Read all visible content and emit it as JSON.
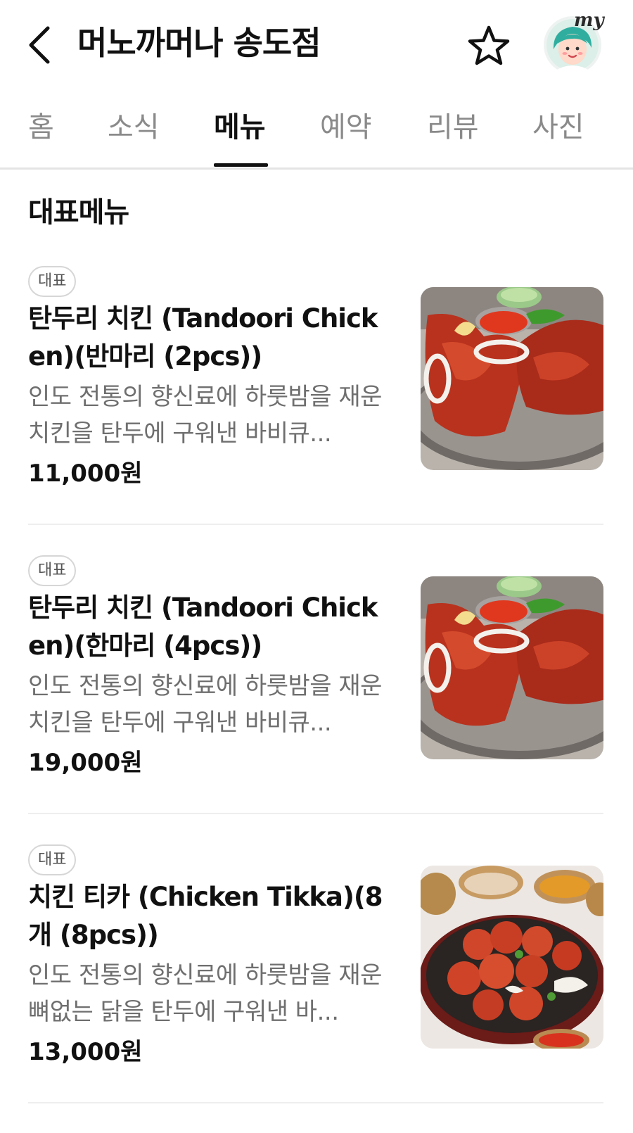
{
  "header": {
    "title": "머노까머나 송도점",
    "back_icon": "chevron-left-icon",
    "favorite_icon": "star-outline-icon",
    "profile_badge": "my"
  },
  "tabs": [
    {
      "label": "홈",
      "active": false
    },
    {
      "label": "소식",
      "active": false
    },
    {
      "label": "메뉴",
      "active": true
    },
    {
      "label": "예약",
      "active": false
    },
    {
      "label": "리뷰",
      "active": false
    },
    {
      "label": "사진",
      "active": false
    }
  ],
  "section": {
    "title": "대표메뉴"
  },
  "menu_items": [
    {
      "badge": "대표",
      "name": "탄두리 치킨 (Tandoori Chicken)(반마리 (2pcs))",
      "description": "인도 전통의 향신료에 하룻밤을 재운 치킨을 탄두에 구워낸 바비큐...",
      "price": "11,000원",
      "photo": "tandoori-chicken-photo"
    },
    {
      "badge": "대표",
      "name": "탄두리 치킨 (Tandoori Chicken)(한마리 (4pcs))",
      "description": "인도 전통의 향신료에 하룻밤을 재운 치킨을 탄두에 구워낸 바비큐...",
      "price": "19,000원",
      "photo": "tandoori-chicken-photo"
    },
    {
      "badge": "대표",
      "name": "치킨 티카 (Chicken Tikka)(8개 (8pcs))",
      "description": "인도 전통의 향신료에 하룻밤을 재운 뼈없는 닭을 탄두에 구워낸 바...",
      "price": "13,000원",
      "photo": "chicken-tikka-photo"
    }
  ],
  "colors": {
    "accent_active_tab": "#111111",
    "inactive_tab": "#8a8a8a",
    "description_text": "#6f6f6f",
    "avatar_bg": "#dcefe8"
  }
}
